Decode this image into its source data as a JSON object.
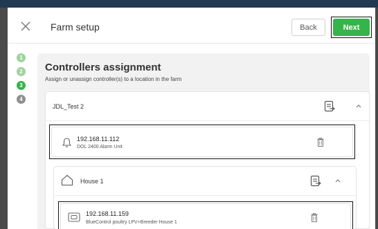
{
  "header": {
    "title": "Farm setup",
    "back_label": "Back",
    "next_label": "Next"
  },
  "steps": [
    "1",
    "2",
    "3",
    "4"
  ],
  "current_step": 3,
  "main": {
    "title": "Controllers assignment",
    "subtitle": "Assign or unassign controller(s) to a location in the farm"
  },
  "location": {
    "name": "JDL_Test 2",
    "controller": {
      "ip": "192.168.11.112",
      "type": "DOL 2400 Alarm Unit",
      "icon": "bell-icon"
    },
    "house": {
      "name": "House 1",
      "icon": "house-icon",
      "controller": {
        "ip": "192.168.11.159",
        "type": "BlueControl poultry LPV+Breeder House 1",
        "icon": "controller-icon"
      }
    }
  },
  "colors": {
    "accent": "#35b44a",
    "step_done": "#9fd49d",
    "step_todo": "#8f8f8f",
    "panel_bg": "#f2f2f2"
  }
}
